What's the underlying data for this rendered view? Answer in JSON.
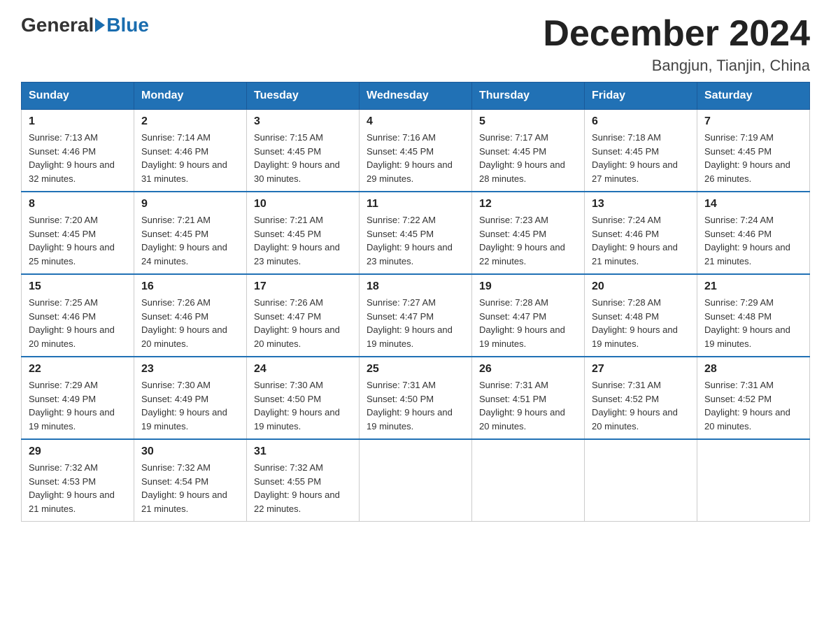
{
  "logo": {
    "general": "General",
    "blue": "Blue"
  },
  "title": {
    "month": "December 2024",
    "location": "Bangjun, Tianjin, China"
  },
  "weekdays": [
    "Sunday",
    "Monday",
    "Tuesday",
    "Wednesday",
    "Thursday",
    "Friday",
    "Saturday"
  ],
  "weeks": [
    [
      {
        "day": "1",
        "sunrise": "7:13 AM",
        "sunset": "4:46 PM",
        "daylight": "9 hours and 32 minutes."
      },
      {
        "day": "2",
        "sunrise": "7:14 AM",
        "sunset": "4:46 PM",
        "daylight": "9 hours and 31 minutes."
      },
      {
        "day": "3",
        "sunrise": "7:15 AM",
        "sunset": "4:45 PM",
        "daylight": "9 hours and 30 minutes."
      },
      {
        "day": "4",
        "sunrise": "7:16 AM",
        "sunset": "4:45 PM",
        "daylight": "9 hours and 29 minutes."
      },
      {
        "day": "5",
        "sunrise": "7:17 AM",
        "sunset": "4:45 PM",
        "daylight": "9 hours and 28 minutes."
      },
      {
        "day": "6",
        "sunrise": "7:18 AM",
        "sunset": "4:45 PM",
        "daylight": "9 hours and 27 minutes."
      },
      {
        "day": "7",
        "sunrise": "7:19 AM",
        "sunset": "4:45 PM",
        "daylight": "9 hours and 26 minutes."
      }
    ],
    [
      {
        "day": "8",
        "sunrise": "7:20 AM",
        "sunset": "4:45 PM",
        "daylight": "9 hours and 25 minutes."
      },
      {
        "day": "9",
        "sunrise": "7:21 AM",
        "sunset": "4:45 PM",
        "daylight": "9 hours and 24 minutes."
      },
      {
        "day": "10",
        "sunrise": "7:21 AM",
        "sunset": "4:45 PM",
        "daylight": "9 hours and 23 minutes."
      },
      {
        "day": "11",
        "sunrise": "7:22 AM",
        "sunset": "4:45 PM",
        "daylight": "9 hours and 23 minutes."
      },
      {
        "day": "12",
        "sunrise": "7:23 AM",
        "sunset": "4:45 PM",
        "daylight": "9 hours and 22 minutes."
      },
      {
        "day": "13",
        "sunrise": "7:24 AM",
        "sunset": "4:46 PM",
        "daylight": "9 hours and 21 minutes."
      },
      {
        "day": "14",
        "sunrise": "7:24 AM",
        "sunset": "4:46 PM",
        "daylight": "9 hours and 21 minutes."
      }
    ],
    [
      {
        "day": "15",
        "sunrise": "7:25 AM",
        "sunset": "4:46 PM",
        "daylight": "9 hours and 20 minutes."
      },
      {
        "day": "16",
        "sunrise": "7:26 AM",
        "sunset": "4:46 PM",
        "daylight": "9 hours and 20 minutes."
      },
      {
        "day": "17",
        "sunrise": "7:26 AM",
        "sunset": "4:47 PM",
        "daylight": "9 hours and 20 minutes."
      },
      {
        "day": "18",
        "sunrise": "7:27 AM",
        "sunset": "4:47 PM",
        "daylight": "9 hours and 19 minutes."
      },
      {
        "day": "19",
        "sunrise": "7:28 AM",
        "sunset": "4:47 PM",
        "daylight": "9 hours and 19 minutes."
      },
      {
        "day": "20",
        "sunrise": "7:28 AM",
        "sunset": "4:48 PM",
        "daylight": "9 hours and 19 minutes."
      },
      {
        "day": "21",
        "sunrise": "7:29 AM",
        "sunset": "4:48 PM",
        "daylight": "9 hours and 19 minutes."
      }
    ],
    [
      {
        "day": "22",
        "sunrise": "7:29 AM",
        "sunset": "4:49 PM",
        "daylight": "9 hours and 19 minutes."
      },
      {
        "day": "23",
        "sunrise": "7:30 AM",
        "sunset": "4:49 PM",
        "daylight": "9 hours and 19 minutes."
      },
      {
        "day": "24",
        "sunrise": "7:30 AM",
        "sunset": "4:50 PM",
        "daylight": "9 hours and 19 minutes."
      },
      {
        "day": "25",
        "sunrise": "7:31 AM",
        "sunset": "4:50 PM",
        "daylight": "9 hours and 19 minutes."
      },
      {
        "day": "26",
        "sunrise": "7:31 AM",
        "sunset": "4:51 PM",
        "daylight": "9 hours and 20 minutes."
      },
      {
        "day": "27",
        "sunrise": "7:31 AM",
        "sunset": "4:52 PM",
        "daylight": "9 hours and 20 minutes."
      },
      {
        "day": "28",
        "sunrise": "7:31 AM",
        "sunset": "4:52 PM",
        "daylight": "9 hours and 20 minutes."
      }
    ],
    [
      {
        "day": "29",
        "sunrise": "7:32 AM",
        "sunset": "4:53 PM",
        "daylight": "9 hours and 21 minutes."
      },
      {
        "day": "30",
        "sunrise": "7:32 AM",
        "sunset": "4:54 PM",
        "daylight": "9 hours and 21 minutes."
      },
      {
        "day": "31",
        "sunrise": "7:32 AM",
        "sunset": "4:55 PM",
        "daylight": "9 hours and 22 minutes."
      },
      null,
      null,
      null,
      null
    ]
  ]
}
